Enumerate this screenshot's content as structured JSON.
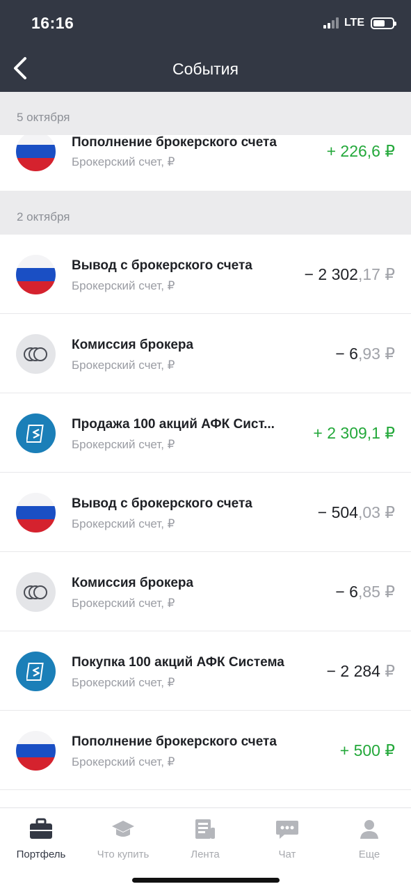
{
  "status_bar": {
    "time": "16:16",
    "network": "LTE"
  },
  "header": {
    "title": "События"
  },
  "sections": [
    {
      "date": "5 октября",
      "items": [
        {
          "icon": "russia-flag-icon",
          "title": "Пополнение брокерского счета",
          "subtitle": "Брокерский счет, ₽",
          "amount_main": "+ 226,6",
          "amount_frac": "",
          "currency": " ₽",
          "sign": "positive"
        }
      ]
    },
    {
      "date": "2 октября",
      "items": [
        {
          "icon": "russia-flag-icon",
          "title": "Вывод с брокерского счета",
          "subtitle": "Брокерский счет, ₽",
          "amount_main": "− 2 302",
          "amount_frac": ",17",
          "currency": " ₽",
          "sign": "negative"
        },
        {
          "icon": "coins-icon",
          "title": "Комиссия брокера",
          "subtitle": "Брокерский счет, ₽",
          "amount_main": "− 6",
          "amount_frac": ",93",
          "currency": " ₽",
          "sign": "negative"
        },
        {
          "icon": "afk-sistema-logo-icon",
          "title": "Продажа 100 акций АФК Сист...",
          "subtitle": "Брокерский счет, ₽",
          "amount_main": "+ 2 309,1",
          "amount_frac": "",
          "currency": " ₽",
          "sign": "positive"
        },
        {
          "icon": "russia-flag-icon",
          "title": "Вывод с брокерского счета",
          "subtitle": "Брокерский счет, ₽",
          "amount_main": "− 504",
          "amount_frac": ",03",
          "currency": " ₽",
          "sign": "negative"
        },
        {
          "icon": "coins-icon",
          "title": "Комиссия брокера",
          "subtitle": "Брокерский счет, ₽",
          "amount_main": "− 6",
          "amount_frac": ",85",
          "currency": " ₽",
          "sign": "negative"
        },
        {
          "icon": "afk-sistema-logo-icon",
          "title": "Покупка 100 акций АФК Система",
          "subtitle": "Брокерский счет, ₽",
          "amount_main": "− 2 284",
          "amount_frac": "",
          "currency": " ₽",
          "sign": "negative"
        },
        {
          "icon": "russia-flag-icon",
          "title": "Пополнение брокерского счета",
          "subtitle": "Брокерский счет, ₽",
          "amount_main": "+ 500",
          "amount_frac": "",
          "currency": " ₽",
          "sign": "positive"
        }
      ]
    }
  ],
  "tabbar": {
    "tabs": [
      {
        "label": "Портфель",
        "icon": "briefcase-icon",
        "active": true
      },
      {
        "label": "Что купить",
        "icon": "graduation-cap-icon",
        "active": false
      },
      {
        "label": "Лента",
        "icon": "newspaper-icon",
        "active": false
      },
      {
        "label": "Чат",
        "icon": "chat-bubble-icon",
        "active": false
      },
      {
        "label": "Еще",
        "icon": "profile-icon",
        "active": false
      }
    ]
  },
  "colors": {
    "header_bg": "#333844",
    "positive": "#23a83a",
    "muted": "#a0a2a8",
    "section_bg": "#ebebed"
  }
}
